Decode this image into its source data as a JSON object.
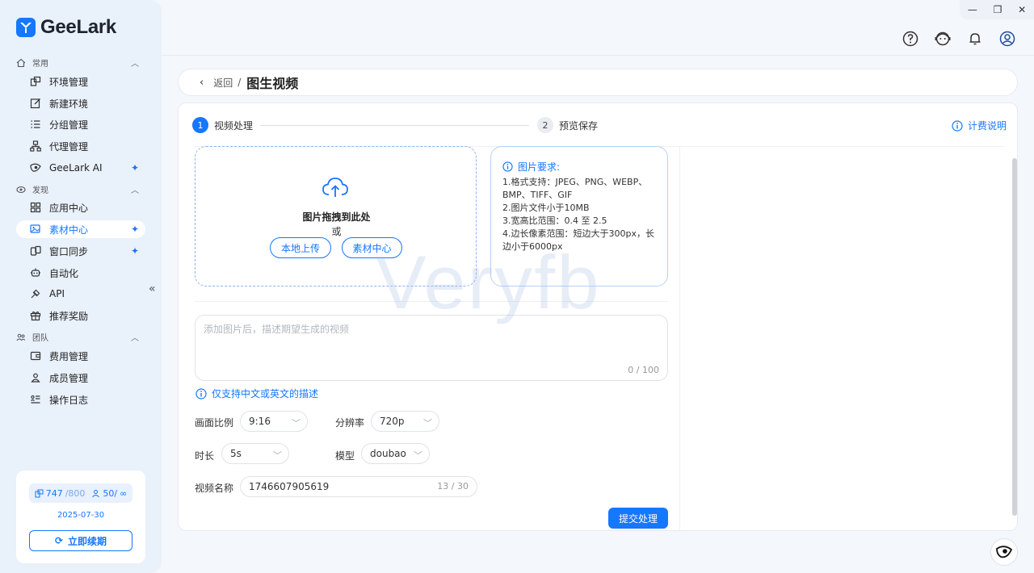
{
  "app": {
    "name": "GeeLark"
  },
  "sidebar": {
    "sections": [
      {
        "label": "常用",
        "icon": "home-icon"
      },
      {
        "label": "发现",
        "icon": "discover-icon"
      },
      {
        "label": "团队",
        "icon": "team-icon"
      }
    ],
    "items": [
      {
        "label": "环境管理",
        "icon": "environment-icon"
      },
      {
        "label": "新建环境",
        "icon": "edit-icon"
      },
      {
        "label": "分组管理",
        "icon": "list-icon"
      },
      {
        "label": "代理管理",
        "icon": "proxy-icon"
      },
      {
        "label": "GeeLark AI",
        "icon": "ai-icon"
      },
      {
        "label": "应用中心",
        "icon": "apps-icon"
      },
      {
        "label": "素材中心",
        "icon": "image-icon",
        "active": true
      },
      {
        "label": "窗口同步",
        "icon": "sync-icon"
      },
      {
        "label": "自动化",
        "icon": "robot-icon"
      },
      {
        "label": "API",
        "icon": "api-icon"
      },
      {
        "label": "推荐奖励",
        "icon": "gift-icon"
      },
      {
        "label": "费用管理",
        "icon": "wallet-icon"
      },
      {
        "label": "成员管理",
        "icon": "user-icon"
      },
      {
        "label": "操作日志",
        "icon": "log-icon"
      }
    ],
    "account": {
      "devices": "747",
      "devices_total": "/800",
      "members": "50/",
      "members_total": "∞",
      "expire_date": "2025-07-30",
      "renew_label": "立即续期"
    }
  },
  "topbar": {
    "icons": [
      "help-icon",
      "support-icon",
      "bell-icon",
      "profile-icon"
    ]
  },
  "breadcrumb": {
    "back_label": "返回",
    "separator": "/",
    "title": "图生视频"
  },
  "steps": [
    {
      "num": "1",
      "label": "视频处理",
      "active": true
    },
    {
      "num": "2",
      "label": "预览保存",
      "active": false
    }
  ],
  "billing_label": "计费说明",
  "upload": {
    "title": "图片拖拽到此处",
    "or": "或",
    "local_upload": "本地上传",
    "material_center": "素材中心"
  },
  "requirements": {
    "title": "图片要求:",
    "lines": [
      "1.格式支持：JPEG、PNG、WEBP、BMP、TIFF、GIF",
      "2.图片文件小于10MB",
      "3.宽高比范围：0.4 至 2.5",
      "4.边长像素范围：短边大于300px，长边小于6000px"
    ]
  },
  "description": {
    "placeholder": "添加图片后，描述期望生成的视频",
    "count": "0 / 100"
  },
  "lang_note": "仅支持中文或英文的描述",
  "form": {
    "aspect_label": "画面比例",
    "aspect_value": "9:16",
    "resolution_label": "分辨率",
    "resolution_value": "720p",
    "duration_label": "时长",
    "duration_value": "5s",
    "model_label": "模型",
    "model_value": "doubao",
    "name_label": "视频名称",
    "name_value": "1746607905619",
    "name_count": "13 / 30"
  },
  "submit_label": "提交处理",
  "watermark": "Veryfb"
}
